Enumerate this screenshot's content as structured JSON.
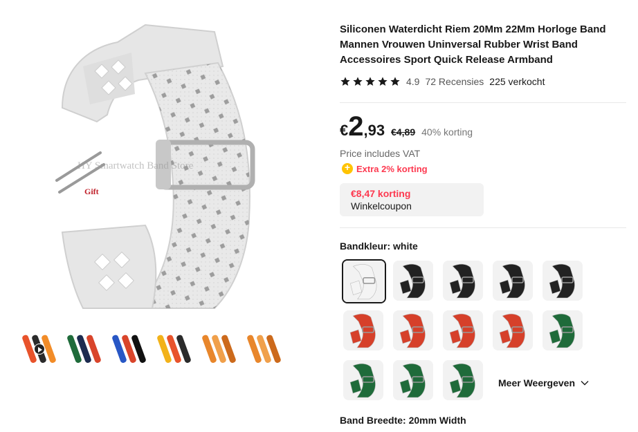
{
  "gallery": {
    "watermark": "HY Smartwatch Band Store",
    "gift_label": "Gift",
    "thumbnails": [
      {
        "colors": [
          "#e8532b",
          "#2b2b2b",
          "#f28c28"
        ],
        "video": true
      },
      {
        "colors": [
          "#1f6b3a",
          "#1d2b4f",
          "#d9452b"
        ],
        "video": false
      },
      {
        "colors": [
          "#2857c5",
          "#d9452b",
          "#111111"
        ],
        "video": false
      },
      {
        "colors": [
          "#f2b21a",
          "#e8532b",
          "#2b2b2b"
        ],
        "video": false
      },
      {
        "colors": [
          "#e8862b",
          "#f0a04b",
          "#cc6a1c"
        ],
        "video": false
      },
      {
        "colors": [
          "#e8862b",
          "#f0a04b",
          "#cc6a1c"
        ],
        "video": false
      }
    ]
  },
  "product": {
    "title": "Siliconen Waterdicht Riem 20Mm 22Mm Horloge Band Mannen Vrouwen Uninversal Rubber Wrist Band Accessoires Sport Quick Release Armband",
    "rating": "4.9",
    "reviews": "72 Recensies",
    "sold": "225 verkocht",
    "price": {
      "currency": "€",
      "integer": "2",
      "decimal": ",93",
      "original": "€4,89",
      "discount": "40% korting"
    },
    "vat_note": "Price includes VAT",
    "extra_discount": "Extra 2% korting",
    "coupon": {
      "amount": "€8,47 korting",
      "label": "Winkelcoupon"
    }
  },
  "variants": {
    "color_label": "Bandkleur: white",
    "swatches": [
      {
        "color": "#f4f4f4",
        "selected": true
      },
      {
        "color": "#222222",
        "selected": false
      },
      {
        "color": "#222222",
        "selected": false
      },
      {
        "color": "#222222",
        "selected": false
      },
      {
        "color": "#222222",
        "selected": false
      },
      {
        "color": "#d6402a",
        "selected": false
      },
      {
        "color": "#d6402a",
        "selected": false
      },
      {
        "color": "#d6402a",
        "selected": false
      },
      {
        "color": "#d6402a",
        "selected": false
      },
      {
        "color": "#1f6b3a",
        "selected": false
      },
      {
        "color": "#1f6b3a",
        "selected": false
      },
      {
        "color": "#1f6b3a",
        "selected": false
      },
      {
        "color": "#1f6b3a",
        "selected": false
      }
    ],
    "show_more": "Meer Weergeven",
    "width_label": "Band Breedte: 20mm Width"
  },
  "colors": {
    "accent_red": "#fd384f",
    "coin_yellow": "#ffc300",
    "text_dark": "#191919"
  }
}
